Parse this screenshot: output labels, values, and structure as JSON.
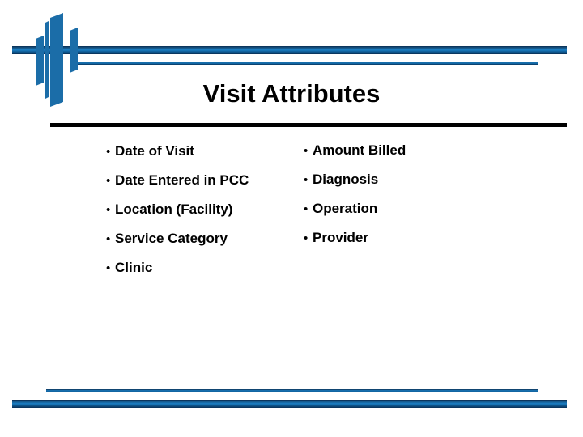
{
  "slide": {
    "title": "Visit Attributes",
    "bullet_marker": "•",
    "columns": {
      "left": [
        {
          "label": "Date of Visit"
        },
        {
          "label": "Date Entered in PCC"
        },
        {
          "label": "Location (Facility)"
        },
        {
          "label": "Service Category"
        },
        {
          "label": "Clinic"
        }
      ],
      "right": [
        {
          "label": "Amount Billed"
        },
        {
          "label": "Diagnosis"
        },
        {
          "label": "Operation"
        },
        {
          "label": "Provider"
        }
      ]
    },
    "decoration": {
      "logo_name": "slanted-bars-logo",
      "accent_color": "#1b7fc4",
      "accent_dark_color": "#0a2c50",
      "rule_color": "#000000",
      "background_color": "#ffffff"
    }
  }
}
